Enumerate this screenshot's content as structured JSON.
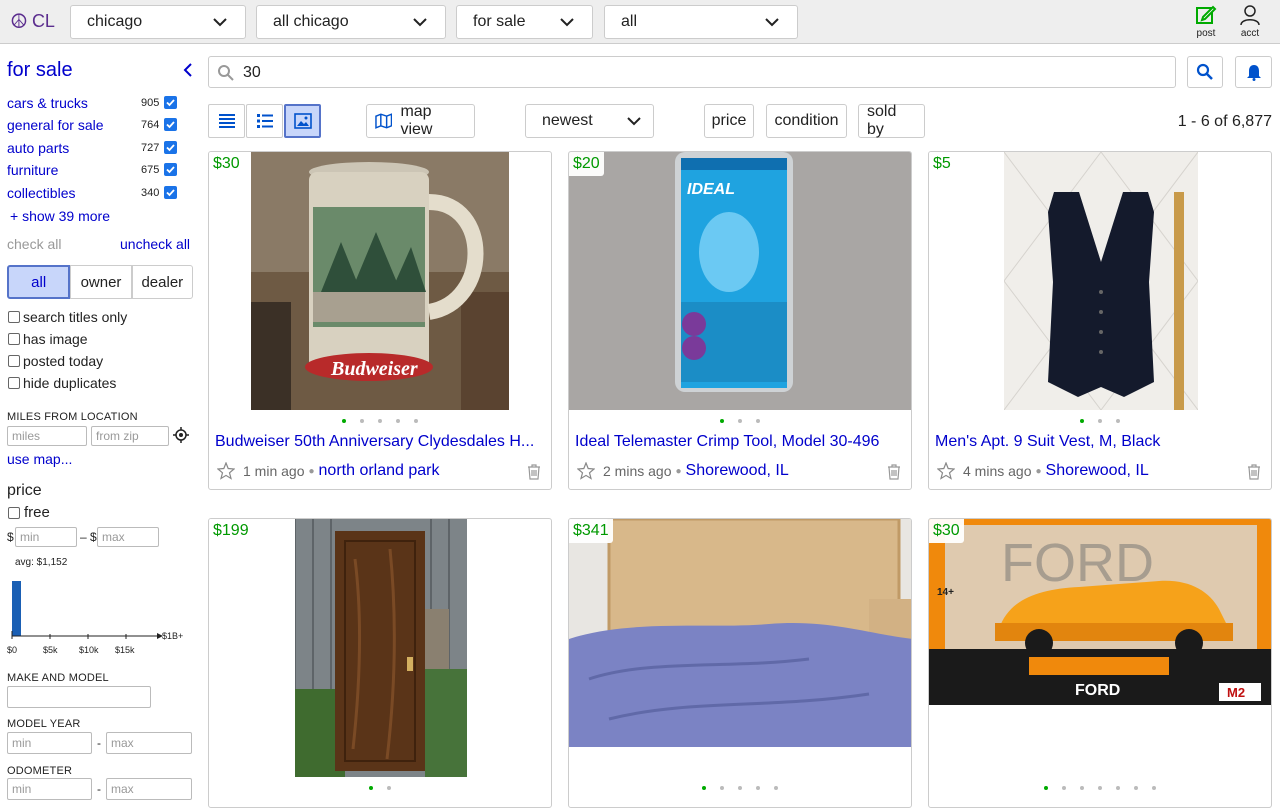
{
  "header": {
    "logo_text": "CL",
    "selects": [
      "chicago",
      "all chicago",
      "for sale",
      "all"
    ],
    "post_label": "post",
    "acct_label": "acct"
  },
  "sidebar": {
    "title": "for sale",
    "categories": [
      {
        "label": "cars & trucks",
        "count": "905"
      },
      {
        "label": "general for sale",
        "count": "764"
      },
      {
        "label": "auto parts",
        "count": "727"
      },
      {
        "label": "furniture",
        "count": "675"
      },
      {
        "label": "collectibles",
        "count": "340"
      }
    ],
    "show_more": "+ show 39 more",
    "check_all": "check all",
    "uncheck_all": "uncheck all",
    "seller_types": [
      "all",
      "owner",
      "dealer"
    ],
    "options": [
      "search titles only",
      "has image",
      "posted today",
      "hide duplicates"
    ],
    "miles_label": "MILES FROM LOCATION",
    "miles_placeholder": "miles",
    "zip_placeholder": "from zip",
    "use_map": "use map...",
    "price_label": "price",
    "free_label": "free",
    "currency_symbol": "$",
    "range_sep": "–",
    "min_placeholder": "min",
    "max_placeholder": "max",
    "avg_label": "avg: $1,152",
    "histogram_ticks": [
      "$0",
      "$5k",
      "$10k",
      "$15k",
      "$1B+"
    ],
    "make_model_label": "MAKE AND MODEL",
    "model_year_label": "MODEL YEAR",
    "odometer_label": "ODOMETER",
    "dash": "-"
  },
  "search": {
    "query": "30"
  },
  "toolbar": {
    "map_view": "map view",
    "sort": "newest",
    "filters": [
      "price",
      "condition",
      "sold by"
    ],
    "result_count": "1 - 6 of 6,877"
  },
  "listings": [
    {
      "price": "$30",
      "title": "Budweiser 50th Anniversary Clydesdales H...",
      "ago": "1 min ago",
      "location": "north orland park",
      "dots": 5
    },
    {
      "price": "$20",
      "title": "Ideal Telemaster Crimp Tool, Model 30-496",
      "ago": "2 mins ago",
      "location": "Shorewood, IL",
      "dots": 3
    },
    {
      "price": "$5",
      "title": "Men's Apt. 9 Suit Vest, M, Black",
      "ago": "4 mins ago",
      "location": "Shorewood, IL",
      "dots": 3
    },
    {
      "price": "$199",
      "dots": 2
    },
    {
      "price": "$341",
      "dots": 5
    },
    {
      "price": "$30",
      "dots": 7
    }
  ],
  "product_image_text": {
    "mug": "Budweiser",
    "tool_brand": "IDEAL",
    "box_brand": "FORD",
    "box_badge": "M2",
    "box_age": "14+"
  }
}
